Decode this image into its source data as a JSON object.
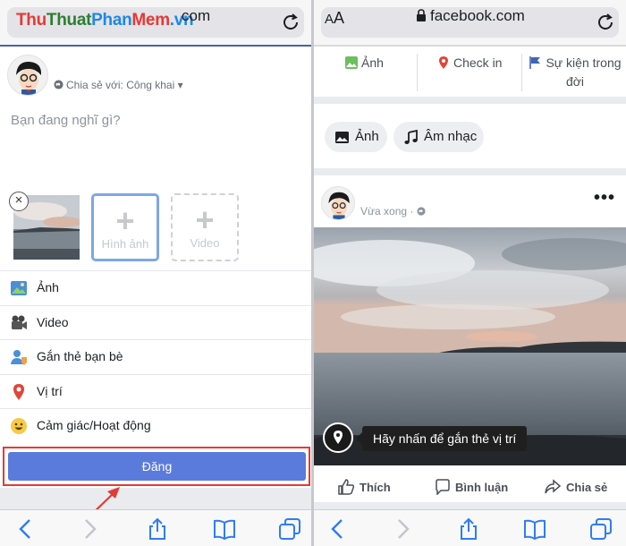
{
  "left": {
    "watermark": {
      "part1": "Thu",
      "part2": "Thuat",
      "part3": "Phan",
      "part4": "Mem",
      "part5": ".vn"
    },
    "url_text": "com",
    "composer": {
      "share_prefix": "Chia sẻ với:",
      "share_value": "Công khai",
      "placeholder": "Bạn đang nghĩ gì?",
      "add_photo_label": "Hình ảnh",
      "add_video_label": "Video",
      "menu": [
        {
          "label": "Ảnh",
          "icon": "photo-icon"
        },
        {
          "label": "Video",
          "icon": "video-camera-icon"
        },
        {
          "label": "Gắn thẻ bạn bè",
          "icon": "tag-friends-icon"
        },
        {
          "label": "Vị trí",
          "icon": "location-pin-icon"
        },
        {
          "label": "Cảm giác/Hoạt động",
          "icon": "smiley-icon"
        }
      ],
      "post_button": "Đăng"
    }
  },
  "right": {
    "aa_small": "A",
    "aa_big": "A",
    "url": "facebook.com",
    "actions": {
      "photo": "Ảnh",
      "checkin": "Check in",
      "event_line1": "Sự kiện trong",
      "event_line2": "đời"
    },
    "chips": {
      "photo": "Ảnh",
      "music": "Âm nhạc"
    },
    "post": {
      "time": "Vừa xong ·",
      "tag_hint": "Hãy nhấn để gắn thẻ vị trí",
      "like": "Thích",
      "comment": "Bình luận",
      "share": "Chia sẻ"
    }
  },
  "colors": {
    "fb_blue": "#5b7bdc",
    "highlight_red": "#e53935",
    "divider_gray": "#e9ebee"
  }
}
